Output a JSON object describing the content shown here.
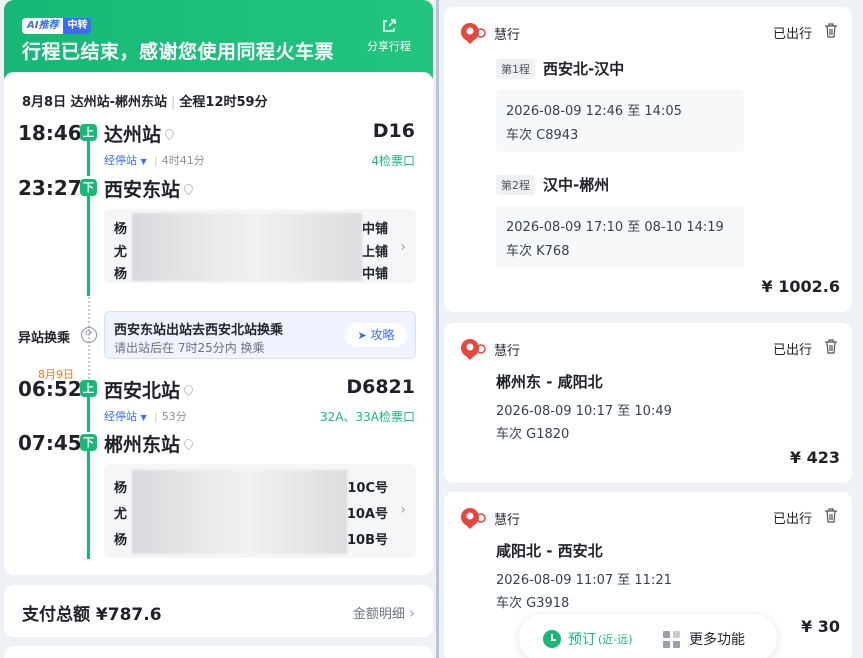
{
  "banner": {
    "ai_label": "AI推荐",
    "ai_sub": "中转",
    "title": "行程已结束，感谢您使用同程火车票",
    "share_label": "分享行程"
  },
  "trip": {
    "summary_date": "8月8日",
    "summary_route": "达州站-郴州东站",
    "summary_duration": "全程12时59分",
    "leg1": {
      "dep_time": "18:46",
      "dep_station": "达州站",
      "dep_badge": "上",
      "train": "D16",
      "via_label": "经停站",
      "duration": "4时41分",
      "gate": "4检票口",
      "arr_time": "23:27",
      "arr_station": "西安东站",
      "arr_badge": "下",
      "passengers": [
        {
          "name": "杨",
          "seat": "中铺"
        },
        {
          "name": "尤",
          "seat": "上铺"
        },
        {
          "name": "杨",
          "seat": "中铺"
        }
      ]
    },
    "transfer": {
      "label": "异站换乘",
      "line1": "西安东站出站去西安北站换乘",
      "line2": "请出站后在 7时25分内 换乘",
      "guide": "攻略"
    },
    "leg2": {
      "date_note": "8月9日",
      "dep_time": "06:52",
      "dep_station": "西安北站",
      "dep_badge": "上",
      "train": "D6821",
      "via_label": "经停站",
      "duration": "53分",
      "gate": "32A、33A检票口",
      "arr_time": "07:45",
      "arr_station": "郴州东站",
      "arr_badge": "下",
      "passengers": [
        {
          "name": "杨",
          "seat": "10C号"
        },
        {
          "name": "尤",
          "seat": "10A号"
        },
        {
          "name": "杨",
          "seat": "10B号"
        }
      ]
    },
    "payment_label": "支付总额",
    "payment_amount": "¥787.6",
    "payment_detail": "金额明细"
  },
  "orders": [
    {
      "brand": "慧行",
      "status": "已出行",
      "legs": [
        {
          "tag": "第1程",
          "route": "西安北-汉中",
          "time": "2026-08-09 12:46 至 14:05",
          "train": "车次 C8943"
        },
        {
          "tag": "第2程",
          "route": "汉中-郴州",
          "time": "2026-08-09 17:10 至 08-10 14:19",
          "train": "车次 K768"
        }
      ],
      "price": "¥ 1002.6"
    },
    {
      "brand": "慧行",
      "status": "已出行",
      "route": "郴州东 - 咸阳北",
      "time": "2026-08-09 10:17 至 10:49",
      "train": "车次 G1820",
      "price": "¥ 423"
    },
    {
      "brand": "慧行",
      "status": "已出行",
      "route": "咸阳北 - 西安北",
      "time": "2026-08-09 11:07 至 11:21",
      "train": "车次 G3918",
      "price": "¥ 30"
    }
  ],
  "fab": {
    "book_label": "预订",
    "book_sub": "(近-远)",
    "more_label": "更多功能"
  },
  "colors": {
    "accent_green": "#18b878",
    "link_blue": "#3a6cf5",
    "date_orange": "#f07a2b"
  }
}
